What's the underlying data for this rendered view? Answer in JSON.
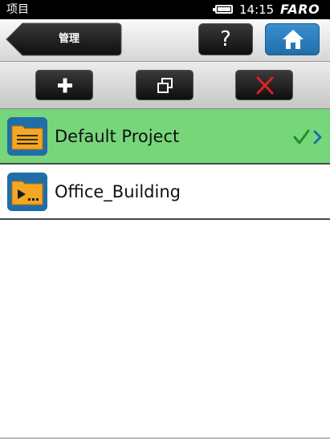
{
  "status_bar": {
    "title": "项目",
    "time": "14:15",
    "brand": "FARO"
  },
  "nav": {
    "back_label": "管理",
    "help_label": "?"
  },
  "toolbar": {
    "add_icon": "plus-icon",
    "copy_icon": "copy-icon",
    "delete_icon": "delete-x-icon"
  },
  "projects": [
    {
      "name": "Default Project",
      "icon": "folder-list-icon",
      "selected": true
    },
    {
      "name": "Office_Building",
      "icon": "folder-scan-icon",
      "selected": false
    }
  ],
  "colors": {
    "selected_row": "#77d67a",
    "home_button": "#2f80c0",
    "delete_x": "#e02020",
    "check_green": "#1f8f2a",
    "folder_orange": "#f5a623"
  }
}
